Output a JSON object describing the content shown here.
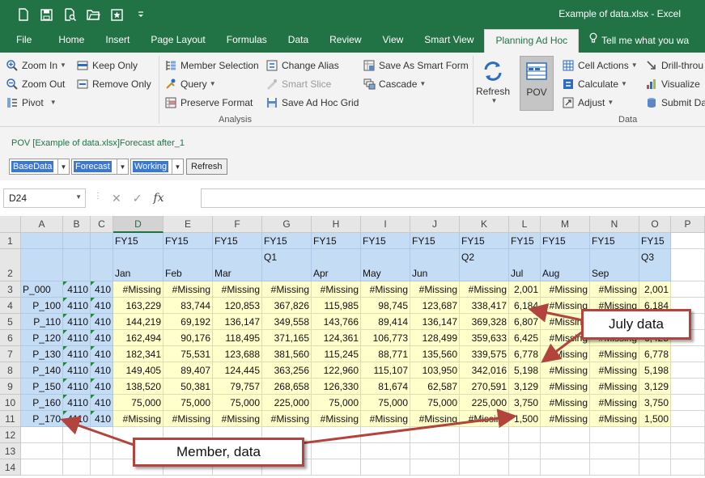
{
  "window": {
    "title": "Example of data.xlsx - Excel"
  },
  "quick_access": [
    "new-file-icon",
    "save-icon",
    "print-preview-icon",
    "open-folder-icon",
    "smart-view-icon",
    "customize-icon"
  ],
  "tabs": [
    "File",
    "Home",
    "Insert",
    "Page Layout",
    "Formulas",
    "Data",
    "Review",
    "View",
    "Smart View",
    "Planning Ad Hoc",
    "Tell me what you wa"
  ],
  "active_tab": "Planning Ad Hoc",
  "ribbon": {
    "col1": [
      "Zoom In",
      "Zoom Out",
      "Pivot"
    ],
    "col2": [
      "Keep Only",
      "Remove Only"
    ],
    "col3": [
      "Member Selection",
      "Query",
      "Preserve Format"
    ],
    "col4": [
      "Change Alias",
      "Smart Slice",
      "Save Ad Hoc Grid"
    ],
    "col5": [
      "Save As Smart Form",
      "Cascade"
    ],
    "refresh_label": "Refresh",
    "pov_label": "POV",
    "col6": [
      "Cell Actions",
      "Calculate",
      "Adjust"
    ],
    "col7": [
      "Drill-throu",
      "Visualize",
      "Submit Dat"
    ],
    "group_analysis": "Analysis",
    "group_data": "Data"
  },
  "pov": {
    "title": "POV [Example of data.xlsx]Forecast after_1",
    "selectors": [
      "BaseData",
      "Forecast",
      "Working"
    ],
    "refresh_button": "Refresh"
  },
  "formula_bar": {
    "name_box": "D24",
    "cancel": "✕",
    "enter": "✓",
    "fx": "fx",
    "value": ""
  },
  "columns": [
    "A",
    "B",
    "C",
    "D",
    "E",
    "F",
    "G",
    "H",
    "I",
    "J",
    "K",
    "L",
    "M",
    "N",
    "O",
    "P"
  ],
  "selected_column": "D",
  "rows": [
    "1",
    "2",
    "3",
    "4",
    "5",
    "6",
    "7",
    "8",
    "9",
    "10",
    "11",
    "12",
    "13",
    "14"
  ],
  "sheet": {
    "row1": [
      "FY15",
      "FY15",
      "FY15",
      "FY15",
      "FY15",
      "FY15",
      "FY15",
      "FY15",
      "FY15",
      "FY15",
      "FY15",
      "FY15"
    ],
    "row2_top": [
      "",
      "",
      "",
      "Q1",
      "",
      "",
      "",
      "Q2",
      "",
      "",
      "",
      "Q3"
    ],
    "row2_bottom": [
      "Jan",
      "Feb",
      "Mar",
      "",
      "Apr",
      "May",
      "Jun",
      "",
      "Jul",
      "Aug",
      "Sep",
      ""
    ],
    "data": [
      {
        "member": "P_000",
        "b": "4110",
        "c": "410",
        "values": [
          "#Missing",
          "#Missing",
          "#Missing",
          "#Missing",
          "#Missing",
          "#Missing",
          "#Missing",
          "#Missing",
          "2,001",
          "#Missing",
          "#Missing",
          "2,001"
        ]
      },
      {
        "member": "P_100",
        "b": "4110",
        "c": "410",
        "values": [
          "163,229",
          "83,744",
          "120,853",
          "367,826",
          "115,985",
          "98,745",
          "123,687",
          "338,417",
          "6,184",
          "#Missing",
          "#Missing",
          "6,184"
        ]
      },
      {
        "member": "P_110",
        "b": "4110",
        "c": "410",
        "values": [
          "144,219",
          "69,192",
          "136,147",
          "349,558",
          "143,766",
          "89,414",
          "136,147",
          "369,328",
          "6,807",
          "#Missing",
          "#Missing",
          "6,807"
        ]
      },
      {
        "member": "P_120",
        "b": "4110",
        "c": "410",
        "values": [
          "162,494",
          "90,176",
          "118,495",
          "371,165",
          "124,361",
          "106,773",
          "128,499",
          "359,633",
          "6,425",
          "#Missing",
          "#Missing",
          "6,425"
        ]
      },
      {
        "member": "P_130",
        "b": "4110",
        "c": "410",
        "values": [
          "182,341",
          "75,531",
          "123,688",
          "381,560",
          "115,245",
          "88,771",
          "135,560",
          "339,575",
          "6,778",
          "#Missing",
          "#Missing",
          "6,778"
        ]
      },
      {
        "member": "P_140",
        "b": "4110",
        "c": "410",
        "values": [
          "149,405",
          "89,407",
          "124,445",
          "363,256",
          "122,960",
          "115,107",
          "103,950",
          "342,016",
          "5,198",
          "#Missing",
          "#Missing",
          "5,198"
        ]
      },
      {
        "member": "P_150",
        "b": "4110",
        "c": "410",
        "values": [
          "138,520",
          "50,381",
          "79,757",
          "268,658",
          "126,330",
          "81,674",
          "62,587",
          "270,591",
          "3,129",
          "#Missing",
          "#Missing",
          "3,129"
        ]
      },
      {
        "member": "P_160",
        "b": "4110",
        "c": "410",
        "values": [
          "75,000",
          "75,000",
          "75,000",
          "225,000",
          "75,000",
          "75,000",
          "75,000",
          "225,000",
          "3,750",
          "#Missing",
          "#Missing",
          "3,750"
        ]
      },
      {
        "member": "P_170",
        "b": "4110",
        "c": "410",
        "values": [
          "#Missing",
          "#Missing",
          "#Missing",
          "#Missing",
          "#Missing",
          "#Missing",
          "#Missing",
          "#Missing",
          "1,500",
          "#Missing",
          "#Missing",
          "1,500"
        ]
      }
    ]
  },
  "callouts": {
    "july": "July data",
    "member": "Member, data"
  },
  "colors": {
    "excel_green": "#217346",
    "header_blue": "#c5dcf5",
    "data_yellow": "#ffffcc",
    "callout_red": "#b3443d"
  }
}
